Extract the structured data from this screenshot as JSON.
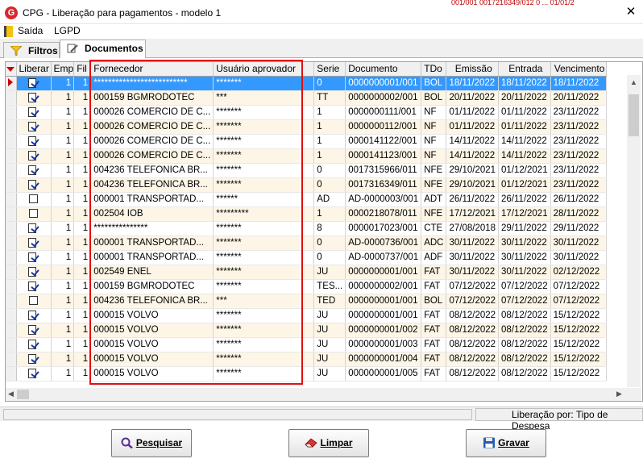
{
  "window": {
    "title": "CPG - Liberação para pagamentos - modelo 1",
    "app_icon_letter": "G",
    "close_glyph": "✕",
    "background_fragment": "001/001 0017216349/012 0 ... 01/01/2"
  },
  "menu": {
    "items": [
      {
        "label": "Saída"
      },
      {
        "label": "LGPD"
      }
    ]
  },
  "tabs": [
    {
      "label": "Filtros",
      "active": false
    },
    {
      "label": "Documentos",
      "active": true
    }
  ],
  "grid": {
    "columns": [
      "Liberar",
      "Emp",
      "Fil",
      "Fornecedor",
      "Usuário aprovador",
      "Serie",
      "Documento",
      "TDo",
      "Emissão",
      "Entrada",
      "Vencimento"
    ],
    "rows": [
      {
        "liberar": "check",
        "emp": "1",
        "fil": "1",
        "fornecedor": "**************************",
        "usuario": "*******",
        "serie": "0",
        "documento": "0000000001/001",
        "tdo": "BOL",
        "emissao": "18/11/2022",
        "entrada": "18/11/2022",
        "vencimento": "18/11/2022"
      },
      {
        "liberar": "check",
        "emp": "1",
        "fil": "1",
        "fornecedor": "000159 BGMRODOTEC",
        "usuario": "***",
        "serie": "TT",
        "documento": "0000000002/001",
        "tdo": "BOL",
        "emissao": "20/11/2022",
        "entrada": "20/11/2022",
        "vencimento": "20/11/2022"
      },
      {
        "liberar": "check",
        "emp": "1",
        "fil": "1",
        "fornecedor": "000026 COMERCIO DE C...",
        "usuario": "*******",
        "serie": "1",
        "documento": "0000000111/001",
        "tdo": "NF",
        "emissao": "01/11/2022",
        "entrada": "01/11/2022",
        "vencimento": "23/11/2022"
      },
      {
        "liberar": "check",
        "emp": "1",
        "fil": "1",
        "fornecedor": "000026 COMERCIO DE C...",
        "usuario": "*******",
        "serie": "1",
        "documento": "0000000112/001",
        "tdo": "NF",
        "emissao": "01/11/2022",
        "entrada": "01/11/2022",
        "vencimento": "23/11/2022"
      },
      {
        "liberar": "check",
        "emp": "1",
        "fil": "1",
        "fornecedor": "000026 COMERCIO DE C...",
        "usuario": "*******",
        "serie": "1",
        "documento": "0000141122/001",
        "tdo": "NF",
        "emissao": "14/11/2022",
        "entrada": "14/11/2022",
        "vencimento": "23/11/2022"
      },
      {
        "liberar": "check",
        "emp": "1",
        "fil": "1",
        "fornecedor": "000026 COMERCIO DE C...",
        "usuario": "*******",
        "serie": "1",
        "documento": "0000141123/001",
        "tdo": "NF",
        "emissao": "14/11/2022",
        "entrada": "14/11/2022",
        "vencimento": "23/11/2022"
      },
      {
        "liberar": "check",
        "emp": "1",
        "fil": "1",
        "fornecedor": "004236 TELEFONICA BR...",
        "usuario": "*******",
        "serie": "0",
        "documento": "0017315966/011",
        "tdo": "NFE",
        "emissao": "29/10/2021",
        "entrada": "01/12/2021",
        "vencimento": "23/11/2022"
      },
      {
        "liberar": "check",
        "emp": "1",
        "fil": "1",
        "fornecedor": "004236 TELEFONICA BR...",
        "usuario": "*******",
        "serie": "0",
        "documento": "0017316349/011",
        "tdo": "NFE",
        "emissao": "29/10/2021",
        "entrada": "01/12/2021",
        "vencimento": "23/11/2022"
      },
      {
        "liberar": "box",
        "emp": "1",
        "fil": "1",
        "fornecedor": "000001 TRANSPORTAD...",
        "usuario": "******",
        "serie": "AD",
        "documento": "AD-0000003/001",
        "tdo": "ADT",
        "emissao": "26/11/2022",
        "entrada": "26/11/2022",
        "vencimento": "26/11/2022"
      },
      {
        "liberar": "box",
        "emp": "1",
        "fil": "1",
        "fornecedor": "002504 IOB",
        "usuario": "*********",
        "serie": "1",
        "documento": "0000218078/011",
        "tdo": "NFE",
        "emissao": "17/12/2021",
        "entrada": "17/12/2021",
        "vencimento": "28/11/2022"
      },
      {
        "liberar": "check",
        "emp": "1",
        "fil": "1",
        "fornecedor": "***************",
        "usuario": "*******",
        "serie": "8",
        "documento": "0000017023/001",
        "tdo": "CTE",
        "emissao": "27/08/2018",
        "entrada": "29/11/2022",
        "vencimento": "29/11/2022"
      },
      {
        "liberar": "check",
        "emp": "1",
        "fil": "1",
        "fornecedor": "000001 TRANSPORTAD...",
        "usuario": "*******",
        "serie": "0",
        "documento": "AD-0000736/001",
        "tdo": "ADC",
        "emissao": "30/11/2022",
        "entrada": "30/11/2022",
        "vencimento": "30/11/2022"
      },
      {
        "liberar": "check",
        "emp": "1",
        "fil": "1",
        "fornecedor": "000001 TRANSPORTAD...",
        "usuario": "*******",
        "serie": "0",
        "documento": "AD-0000737/001",
        "tdo": "ADF",
        "emissao": "30/11/2022",
        "entrada": "30/11/2022",
        "vencimento": "30/11/2022"
      },
      {
        "liberar": "check",
        "emp": "1",
        "fil": "1",
        "fornecedor": "002549 ENEL",
        "usuario": "*******",
        "serie": "JU",
        "documento": "0000000001/001",
        "tdo": "FAT",
        "emissao": "30/11/2022",
        "entrada": "30/11/2022",
        "vencimento": "02/12/2022"
      },
      {
        "liberar": "check",
        "emp": "1",
        "fil": "1",
        "fornecedor": "000159 BGMRODOTEC",
        "usuario": "*******",
        "serie": "TES...",
        "documento": "0000000002/001",
        "tdo": "FAT",
        "emissao": "07/12/2022",
        "entrada": "07/12/2022",
        "vencimento": "07/12/2022"
      },
      {
        "liberar": "box",
        "emp": "1",
        "fil": "1",
        "fornecedor": "004236 TELEFONICA BR...",
        "usuario": "***",
        "serie": "TED",
        "documento": "0000000001/001",
        "tdo": "BOL",
        "emissao": "07/12/2022",
        "entrada": "07/12/2022",
        "vencimento": "07/12/2022"
      },
      {
        "liberar": "check",
        "emp": "1",
        "fil": "1",
        "fornecedor": "000015 VOLVO",
        "usuario": "*******",
        "serie": "JU",
        "documento": "0000000001/001",
        "tdo": "FAT",
        "emissao": "08/12/2022",
        "entrada": "08/12/2022",
        "vencimento": "15/12/2022"
      },
      {
        "liberar": "check",
        "emp": "1",
        "fil": "1",
        "fornecedor": "000015 VOLVO",
        "usuario": "*******",
        "serie": "JU",
        "documento": "0000000001/002",
        "tdo": "FAT",
        "emissao": "08/12/2022",
        "entrada": "08/12/2022",
        "vencimento": "15/12/2022"
      },
      {
        "liberar": "check",
        "emp": "1",
        "fil": "1",
        "fornecedor": "000015 VOLVO",
        "usuario": "*******",
        "serie": "JU",
        "documento": "0000000001/003",
        "tdo": "FAT",
        "emissao": "08/12/2022",
        "entrada": "08/12/2022",
        "vencimento": "15/12/2022"
      },
      {
        "liberar": "check",
        "emp": "1",
        "fil": "1",
        "fornecedor": "000015 VOLVO",
        "usuario": "*******",
        "serie": "JU",
        "documento": "0000000001/004",
        "tdo": "FAT",
        "emissao": "08/12/2022",
        "entrada": "08/12/2022",
        "vencimento": "15/12/2022"
      },
      {
        "liberar": "check",
        "emp": "1",
        "fil": "1",
        "fornecedor": "000015 VOLVO",
        "usuario": "*******",
        "serie": "JU",
        "documento": "0000000001/005",
        "tdo": "FAT",
        "emissao": "08/12/2022",
        "entrada": "08/12/2022",
        "vencimento": "15/12/2022"
      }
    ]
  },
  "status": {
    "left": "",
    "right": "Liberação por: Tipo de Despesa"
  },
  "buttons": {
    "pesquisar": {
      "label": "Pesquisar",
      "icon": "search-icon"
    },
    "limpar": {
      "label": "Limpar",
      "icon": "eraser-icon"
    },
    "gravar": {
      "label": "Gravar",
      "icon": "floppy-disk-icon"
    }
  },
  "colors": {
    "selection": "#3399ff",
    "alt_row": "#fdf5e6",
    "highlight_box": "#e01010",
    "row_indicator": "#cc0000"
  }
}
